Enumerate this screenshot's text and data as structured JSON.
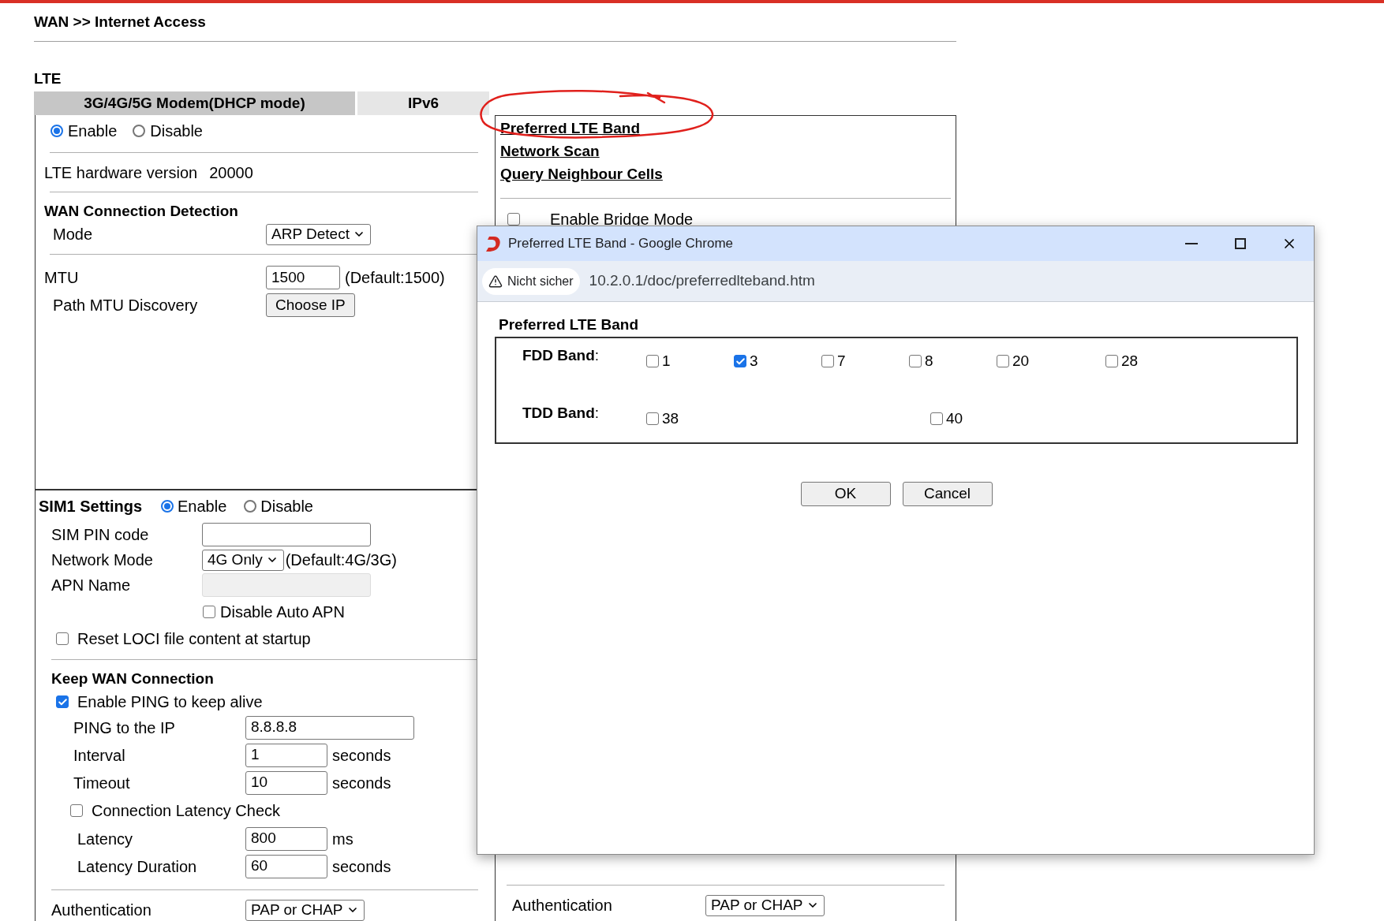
{
  "breadcrumb": "WAN >> Internet Access",
  "section_title": "LTE",
  "tabs": [
    {
      "label": "3G/4G/5G Modem(DHCP mode)",
      "selected": true
    },
    {
      "label": "IPv6",
      "selected": false
    }
  ],
  "lte": {
    "options": [
      {
        "label": "Enable",
        "selected": true
      },
      {
        "label": "Disable",
        "selected": false
      }
    ],
    "hardware_label": "LTE hardware version",
    "hardware_value": "20000"
  },
  "wan_detection": {
    "title": "WAN Connection Detection",
    "mode_label": "Mode",
    "mode_value": "ARP Detect"
  },
  "mtu": {
    "label": "MTU",
    "value": "1500",
    "hint": "(Default:1500)",
    "path_label": "Path MTU Discovery",
    "button": "Choose IP"
  },
  "sim1": {
    "title": "SIM1 Settings",
    "options": [
      {
        "label": "Enable",
        "selected": true
      },
      {
        "label": "Disable",
        "selected": false
      }
    ],
    "pin_label": "SIM PIN code",
    "network_mode_label": "Network Mode",
    "network_mode_value": "4G Only",
    "network_mode_hint": "(Default:4G/3G)",
    "apn_label": "APN Name",
    "apn_disabled": true,
    "auto_apn": {
      "label": "Disable Auto APN",
      "checked": false
    },
    "reset_loci": {
      "label": "Reset LOCI file content at startup",
      "checked": false
    }
  },
  "keep_wan": {
    "title": "Keep WAN Connection",
    "ping": {
      "label": "Enable PING to keep alive",
      "checked": true
    },
    "ping_fields": [
      {
        "label": "PING to the IP",
        "value": "8.8.8.8",
        "kind": "wide"
      },
      {
        "label": "Interval",
        "value": "1",
        "unit": "seconds",
        "kind": "short"
      },
      {
        "label": "Timeout",
        "value": "10",
        "unit": "seconds",
        "kind": "short"
      }
    ],
    "latency_check": {
      "label": "Connection Latency Check",
      "checked": false
    },
    "latency_fields": [
      {
        "label": "Latency",
        "value": "800",
        "unit": "ms",
        "kind": "short"
      },
      {
        "label": "Latency Duration",
        "value": "60",
        "unit": "seconds",
        "kind": "short"
      }
    ]
  },
  "authentication_left": {
    "label": "Authentication",
    "value": "PAP or CHAP"
  },
  "right_panel": {
    "links": [
      "Preferred LTE Band",
      "Network Scan",
      "Query Neighbour Cells"
    ],
    "bridge": {
      "label": "Enable Bridge Mode",
      "checked": false
    },
    "authentication": {
      "label": "Authentication",
      "value": "PAP or CHAP"
    }
  },
  "popup": {
    "title": "Preferred LTE Band - Google Chrome",
    "security": "Nicht sicher",
    "url": "10.2.0.1/doc/preferredlteband.htm",
    "heading": "Preferred LTE Band",
    "band_groups": [
      {
        "label": "**FDD Band**:",
        "bands": [
          {
            "label": "1",
            "checked": false
          },
          {
            "label": "3",
            "checked": true
          },
          {
            "label": "7",
            "checked": false
          },
          {
            "label": "8",
            "checked": false
          },
          {
            "label": "20",
            "checked": false
          },
          {
            "label": "28",
            "checked": false
          }
        ]
      },
      {
        "label": "**TDD Band**:",
        "bands": [
          {
            "label": "38",
            "checked": false
          },
          {
            "label": "40",
            "checked": false
          }
        ]
      }
    ],
    "buttons": [
      "OK",
      "Cancel"
    ]
  }
}
